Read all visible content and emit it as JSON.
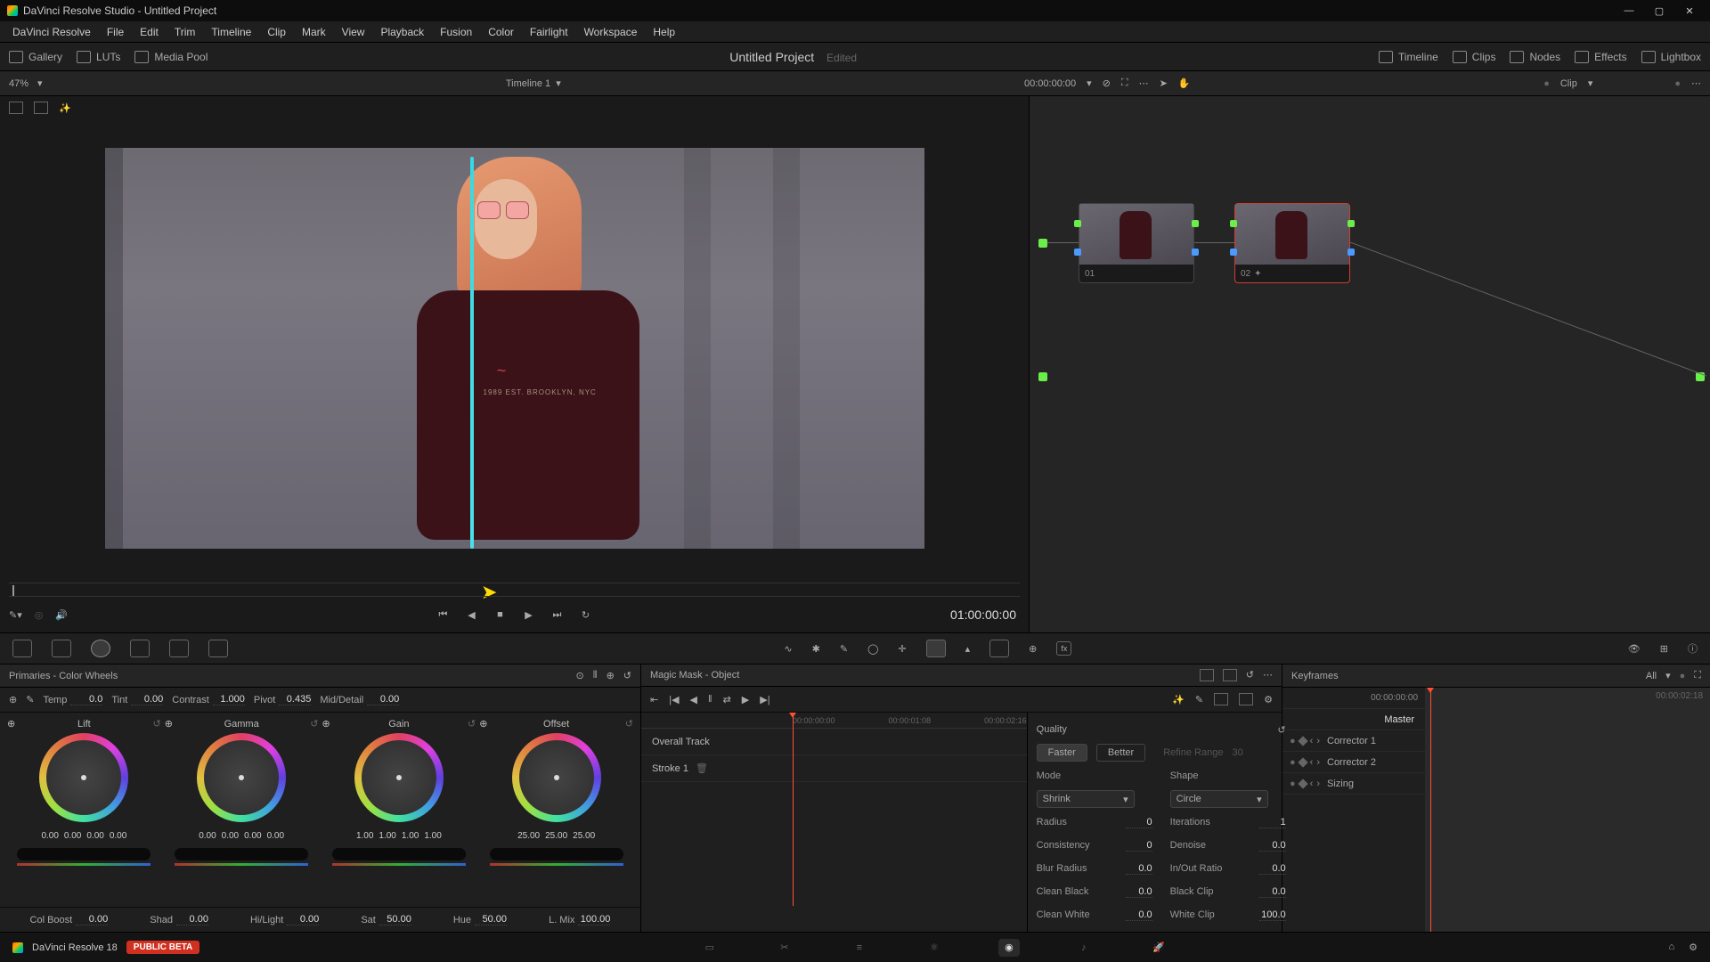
{
  "titlebar": {
    "title": "DaVinci Resolve Studio - Untitled Project"
  },
  "menubar": [
    "DaVinci Resolve",
    "File",
    "Edit",
    "Trim",
    "Timeline",
    "Clip",
    "Mark",
    "View",
    "Playback",
    "Fusion",
    "Color",
    "Fairlight",
    "Workspace",
    "Help"
  ],
  "toolbar": {
    "left": [
      {
        "icon": "gallery-icon",
        "label": "Gallery"
      },
      {
        "icon": "luts-icon",
        "label": "LUTs"
      },
      {
        "icon": "media-pool-icon",
        "label": "Media Pool"
      }
    ],
    "center_title": "Untitled Project",
    "center_status": "Edited",
    "right": [
      {
        "icon": "timeline-icon",
        "label": "Timeline"
      },
      {
        "icon": "clips-icon",
        "label": "Clips"
      },
      {
        "icon": "nodes-icon",
        "label": "Nodes"
      },
      {
        "icon": "effects-icon",
        "label": "Effects"
      },
      {
        "icon": "lightbox-icon",
        "label": "Lightbox"
      }
    ]
  },
  "viewer_header": {
    "zoom": "47%",
    "timeline_name": "Timeline 1",
    "timecode": "00:00:00:00",
    "clip_label": "Clip"
  },
  "transport": {
    "timecode": "01:00:00:00"
  },
  "nodes": {
    "node1_label": "01",
    "node2_label": "02"
  },
  "wheels_panel": {
    "title": "Primaries - Color Wheels",
    "adjust1": {
      "temp_label": "Temp",
      "temp_val": "0.0",
      "tint_label": "Tint",
      "tint_val": "0.00",
      "contrast_label": "Contrast",
      "contrast_val": "1.000",
      "pivot_label": "Pivot",
      "pivot_val": "0.435",
      "mid_label": "Mid/Detail",
      "mid_val": "0.00"
    },
    "wheels": {
      "lift": {
        "name": "Lift",
        "vals": [
          "0.00",
          "0.00",
          "0.00",
          "0.00"
        ]
      },
      "gamma": {
        "name": "Gamma",
        "vals": [
          "0.00",
          "0.00",
          "0.00",
          "0.00"
        ]
      },
      "gain": {
        "name": "Gain",
        "vals": [
          "1.00",
          "1.00",
          "1.00",
          "1.00"
        ]
      },
      "offset": {
        "name": "Offset",
        "vals": [
          "25.00",
          "25.00",
          "25.00"
        ]
      }
    },
    "adjust2": {
      "colboost_label": "Col Boost",
      "colboost_val": "0.00",
      "shad_label": "Shad",
      "shad_val": "0.00",
      "hilight_label": "Hi/Light",
      "hilight_val": "0.00",
      "sat_label": "Sat",
      "sat_val": "50.00",
      "hue_label": "Hue",
      "hue_val": "50.00",
      "lmix_label": "L. Mix",
      "lmix_val": "100.00"
    }
  },
  "mask_panel": {
    "title": "Magic Mask - Object",
    "ruler": [
      "00:00:00:00",
      "00:00:01:08",
      "00:00:02:16"
    ],
    "tracks": {
      "overall": "Overall Track",
      "stroke1": "Stroke 1"
    },
    "props": {
      "quality_label": "Quality",
      "faster": "Faster",
      "better": "Better",
      "refine": "Refine Range",
      "refine_val": "30",
      "mode_label": "Mode",
      "mode_val": "Shrink",
      "shape_label": "Shape",
      "shape_val": "Circle",
      "radius_label": "Radius",
      "radius_val": "0",
      "iter_label": "Iterations",
      "iter_val": "1",
      "consist_label": "Consistency",
      "consist_val": "0",
      "denoise_label": "Denoise",
      "denoise_val": "0.0",
      "blur_label": "Blur Radius",
      "blur_val": "0.0",
      "inout_label": "In/Out Ratio",
      "inout_val": "0.0",
      "cblack_label": "Clean Black",
      "cblack_val": "0.0",
      "bclip_label": "Black Clip",
      "bclip_val": "0.0",
      "cwhite_label": "Clean White",
      "cwhite_val": "0.0",
      "wclip_label": "White Clip",
      "wclip_val": "100.0"
    }
  },
  "keyframes": {
    "title": "Keyframes",
    "all_label": "All",
    "tc_left": "00:00:00:00",
    "tc_right": "00:00:02:18",
    "master": "Master",
    "rows": [
      "Corrector 1",
      "Corrector 2",
      "Sizing"
    ]
  },
  "bottom_nav": {
    "app_name": "DaVinci Resolve 18",
    "beta": "PUBLIC BETA"
  }
}
